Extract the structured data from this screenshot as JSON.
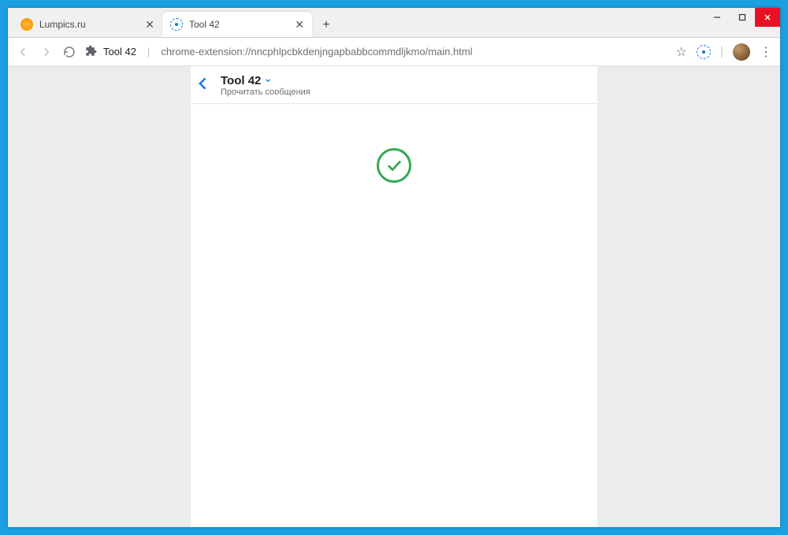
{
  "tabs": [
    {
      "label": "Lumpics.ru"
    },
    {
      "label": "Tool 42"
    }
  ],
  "addressbar": {
    "site_label": "Tool 42",
    "url": "chrome-extension://nncphlpcbkdenjngapbabbcommdljkmo/main.html"
  },
  "page": {
    "title": "Tool 42",
    "subtitle": "Прочитать сообщения"
  }
}
